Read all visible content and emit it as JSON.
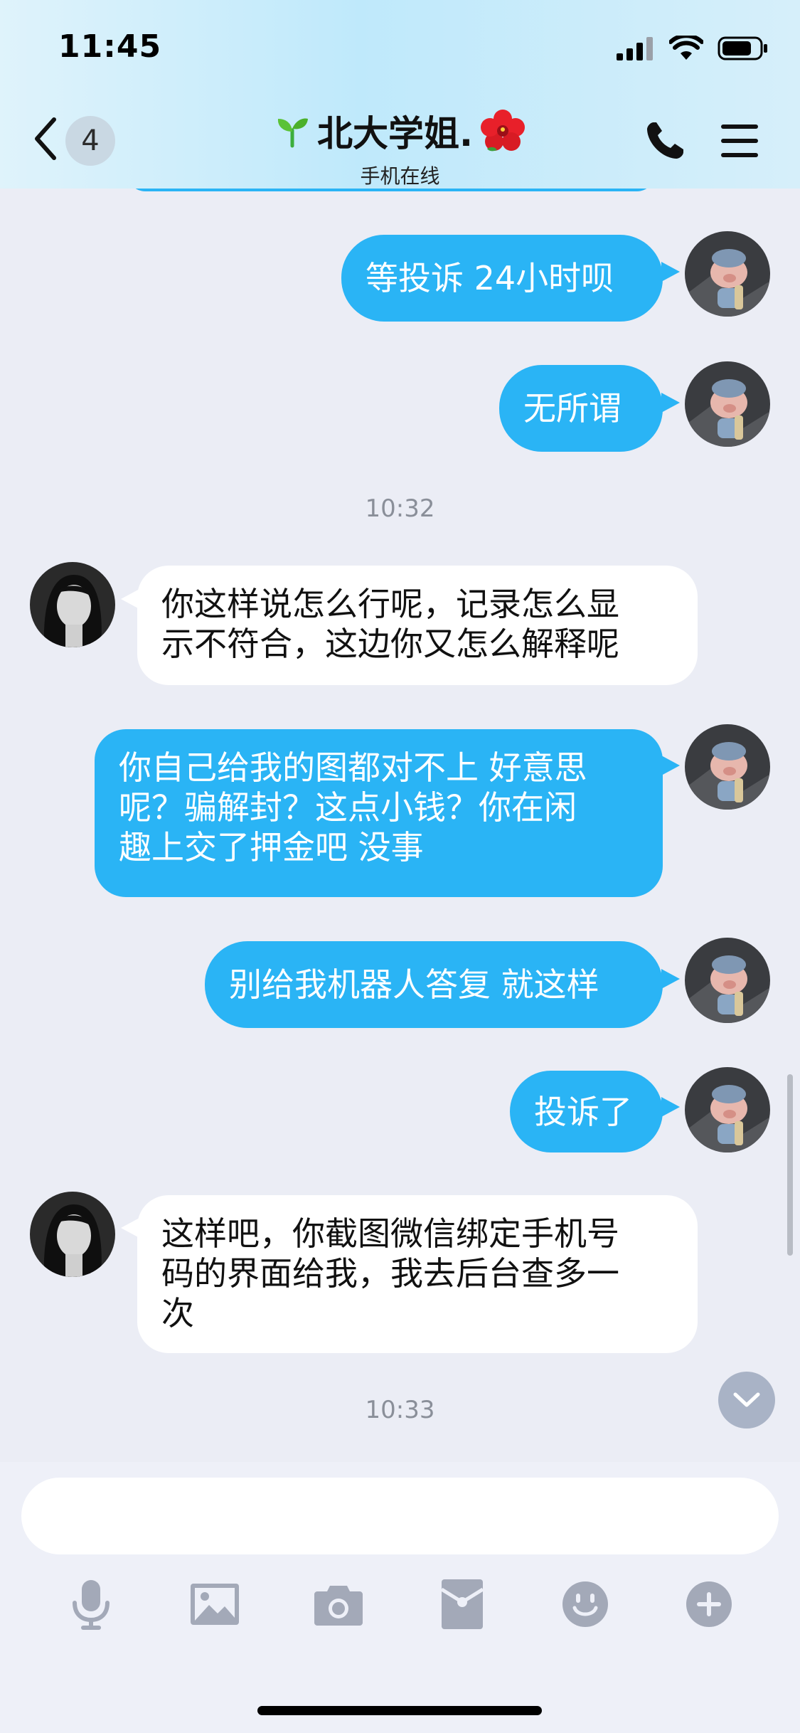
{
  "status_bar": {
    "time": "11:45"
  },
  "header": {
    "unread_count": "4",
    "title": "北大学姐.",
    "subtitle": "手机在线"
  },
  "messages": [
    {
      "side": "out",
      "text": "等投诉 24小时呗"
    },
    {
      "side": "out",
      "text": "无所谓"
    },
    {
      "type": "timestamp",
      "text": "10:32"
    },
    {
      "side": "in",
      "lines": [
        "你这样说怎么行呢，记录怎么显",
        "示不符合，这边你又怎么解释呢"
      ]
    },
    {
      "side": "out",
      "lines": [
        "你自己给我的图都对不上 好意思",
        "呢？骗解封？这点小钱？你在闲",
        "趣上交了押金吧 没事"
      ]
    },
    {
      "side": "out",
      "text": "别给我机器人答复 就这样"
    },
    {
      "side": "out",
      "text": "投诉了"
    },
    {
      "side": "in",
      "lines": [
        "这样吧，你截图微信绑定手机号",
        "码的界面给我，我去后台查多一",
        "次"
      ]
    },
    {
      "type": "timestamp",
      "text": "10:33"
    }
  ],
  "input": {
    "placeholder": ""
  },
  "toolbar": {
    "icons": [
      "microphone-icon",
      "image-icon",
      "camera-icon",
      "red-packet-icon",
      "emoji-icon",
      "plus-icon"
    ]
  },
  "colors": {
    "bubble_out": "#2ab4f5",
    "bubble_in": "#ffffff",
    "background": "#ebedf5",
    "icon_gray": "#a3a9b8"
  }
}
